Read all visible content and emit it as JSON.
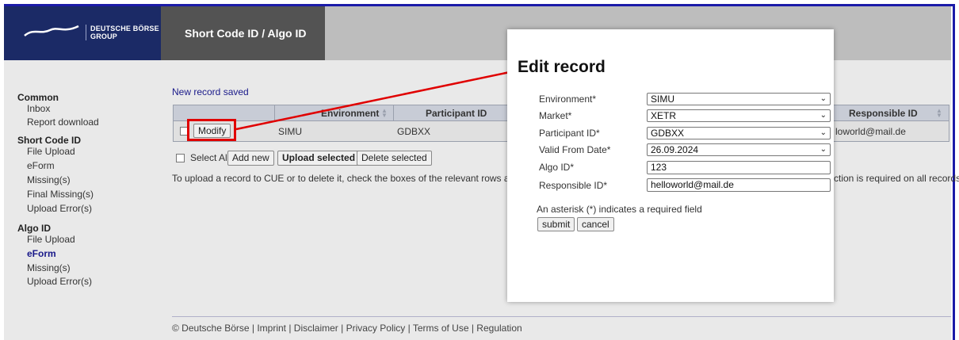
{
  "brand": {
    "logo_line1": "DEUTSCHE BÖRSE",
    "logo_line2": "GROUP",
    "colors": {
      "header_navy": "#1b2a66",
      "header_gray": "#535353",
      "highlight_red": "#e00000",
      "link_blue": "#1a1a8a"
    }
  },
  "header": {
    "title": "Short Code ID / Algo ID"
  },
  "sidebar": {
    "sections": [
      {
        "label": "Common",
        "items": [
          {
            "label": "Inbox"
          },
          {
            "label": "Report download"
          }
        ]
      },
      {
        "label": "Short Code ID",
        "items": [
          {
            "label": "File Upload"
          },
          {
            "label": "eForm"
          },
          {
            "label": "Missing(s)"
          },
          {
            "label": "Final Missing(s)"
          },
          {
            "label": "Upload Error(s)"
          }
        ]
      },
      {
        "label": "Algo ID",
        "items": [
          {
            "label": "File Upload"
          },
          {
            "label": "eForm",
            "active": true
          },
          {
            "label": "Missing(s)"
          },
          {
            "label": "Upload Error(s)"
          }
        ]
      }
    ]
  },
  "main": {
    "status_message": "New record saved",
    "table": {
      "columns": [
        "Environment",
        "Participant ID",
        "Responsible ID"
      ],
      "row": {
        "action": "Modify",
        "environment": "SIMU",
        "participant_id": "GDBXX",
        "responsible_id_partial": "loworld@mail.de"
      }
    },
    "actions": {
      "select_all": "Select All",
      "add_new": "Add new",
      "upload_selected": "Upload selected",
      "delete_selected": "Delete selected"
    },
    "info_text": "To upload a record to CUE or to delete it, check the boxes of the relevant rows and pres",
    "info_text_tail": "ction is required on all records."
  },
  "footer": {
    "text": "© Deutsche Börse | Imprint | Disclaimer | Privacy Policy | Terms of Use | Regulation"
  },
  "modal": {
    "title": "Edit record",
    "fields": {
      "environment": {
        "label": "Environment*",
        "value": "SIMU"
      },
      "market": {
        "label": "Market*",
        "value": "XETR"
      },
      "participant_id": {
        "label": "Participant ID*",
        "value": "GDBXX"
      },
      "valid_from": {
        "label": "Valid From Date*",
        "value": "26.09.2024"
      },
      "algo_id": {
        "label": "Algo ID*",
        "value": "123"
      },
      "responsible_id": {
        "label": "Responsible ID*",
        "value": "helloworld@mail.de"
      }
    },
    "required_note": "An asterisk (*) indicates a required field",
    "submit": "submit",
    "cancel": "cancel"
  }
}
